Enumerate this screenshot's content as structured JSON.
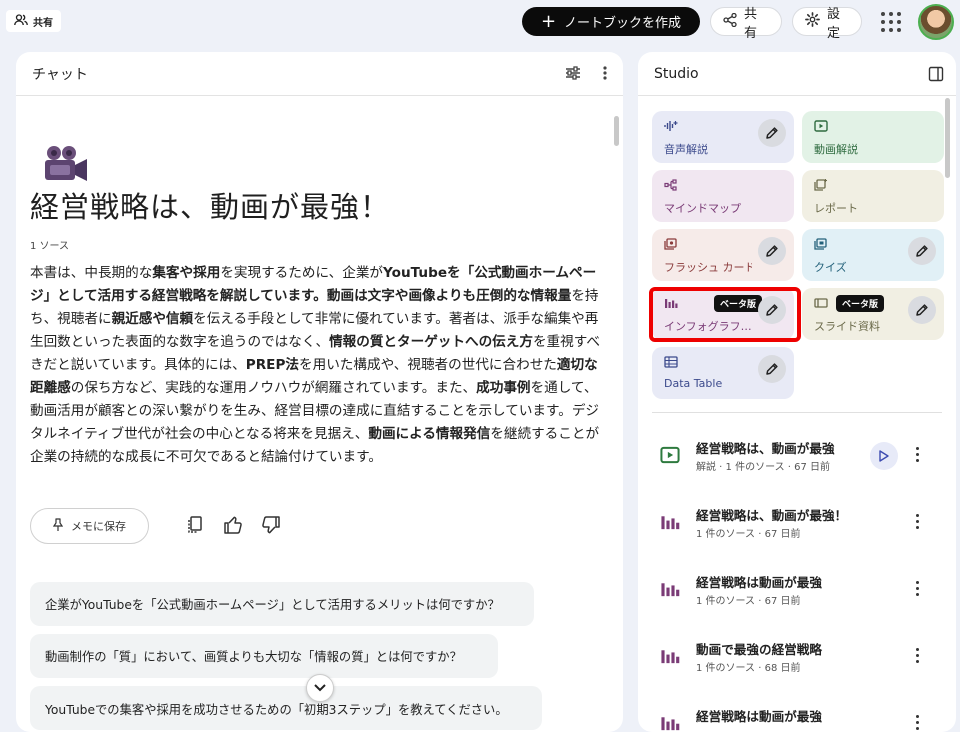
{
  "topbar": {
    "share_chip": "共有",
    "new_notebook": "ノートブックを作成",
    "share_button": "共有",
    "settings_button": "設定"
  },
  "chat": {
    "header": "チャット",
    "title": "経営戦略は、動画が最強！",
    "source_count": "1 ソース",
    "summary": [
      {
        "t": "本書は、中長期的な",
        "b": false
      },
      {
        "t": "集客や採用",
        "b": true
      },
      {
        "t": "を実現するために、企業が",
        "b": false
      },
      {
        "t": "YouTubeを「公式動画ホームページ」として活用する経営戦略を解説しています。",
        "b": true
      },
      {
        "t": "動画は文字や画像よりも圧倒的な情報量",
        "b": true
      },
      {
        "t": "を持ち、視聴者に",
        "b": false
      },
      {
        "t": "親近感や信頼",
        "b": true
      },
      {
        "t": "を伝える手段として非常に優れています。著者は、派手な編集や再生回数といった表面的な数字を追うのではなく、",
        "b": false
      },
      {
        "t": "情報の質とターゲットへの伝え方",
        "b": true
      },
      {
        "t": "を重視すべきだと説いています。具体的には、",
        "b": false
      },
      {
        "t": "PREP法",
        "b": true
      },
      {
        "t": "を用いた構成や、視聴者の世代に合わせた",
        "b": false
      },
      {
        "t": "適切な距離感",
        "b": true
      },
      {
        "t": "の保ち方など、実践的な運用ノウハウが網羅されています。また、",
        "b": false
      },
      {
        "t": "成功事例",
        "b": true
      },
      {
        "t": "を通して、動画活用が顧客との深い繋がりを生み、経営目標の達成に直結することを示しています。デジタルネイティブ世代が社会の中心となる将来を見据え、",
        "b": false
      },
      {
        "t": "動画による情報発信",
        "b": true
      },
      {
        "t": "を継続することが企業の持続的な成長に不可欠であると結論付けています。",
        "b": false
      }
    ],
    "save_memo": "メモに保存",
    "suggestions": [
      "企業がYouTubeを「公式動画ホームページ」として活用するメリットは何ですか？",
      "動画制作の「質」において、画質よりも大切な「情報の質」とは何ですか？",
      "YouTubeでの集客や採用を成功させるための「初期3ステップ」を教えてください。"
    ]
  },
  "studio": {
    "header": "Studio",
    "tiles": [
      {
        "label": "音声解説",
        "icon": "audio-wave-icon",
        "bg": "#e8eaf6",
        "fg": "#3c4a8c",
        "edit": true,
        "beta": ""
      },
      {
        "label": "動画解説",
        "icon": "video-play-icon",
        "bg": "#e2f2e6",
        "fg": "#2e6b3f",
        "edit": false,
        "beta": ""
      },
      {
        "label": "マインドマップ",
        "icon": "mindmap-icon",
        "bg": "#f1e7f1",
        "fg": "#7a3b76",
        "edit": false,
        "beta": ""
      },
      {
        "label": "レポート",
        "icon": "report-icon",
        "bg": "#f1efe3",
        "fg": "#6b6a4a",
        "edit": false,
        "beta": ""
      },
      {
        "label": "フラッシュ カード",
        "icon": "flashcard-icon",
        "bg": "#f6ebe9",
        "fg": "#8a3b3b",
        "edit": true,
        "beta": ""
      },
      {
        "label": "クイズ",
        "icon": "quiz-icon",
        "bg": "#e1f0f6",
        "fg": "#23617a",
        "edit": true,
        "beta": ""
      },
      {
        "label": "インフォグラフ…",
        "icon": "infographic-icon",
        "bg": "#f1e7f1",
        "fg": "#7a3b76",
        "edit": true,
        "beta": "ベータ版"
      },
      {
        "label": "スライド資料",
        "icon": "slides-icon",
        "bg": "#f1efe3",
        "fg": "#6b6a4a",
        "edit": true,
        "beta": "ベータ版"
      },
      {
        "label": "Data Table",
        "icon": "table-icon",
        "bg": "#e8eaf6",
        "fg": "#3c4a8c",
        "edit": true,
        "beta": ""
      }
    ],
    "notes": [
      {
        "title": "経営戦略は、動画が最強",
        "sub": "解説 · 1 件のソース · 67 日前",
        "icon": "video-play-icon",
        "play": true
      },
      {
        "title": "経営戦略は、動画が最強！",
        "sub": "1 件のソース · 67 日前",
        "icon": "infographic-icon",
        "play": false
      },
      {
        "title": "経営戦略は動画が最強",
        "sub": "1 件のソース · 67 日前",
        "icon": "infographic-icon",
        "play": false
      },
      {
        "title": "動画で最強の経営戦略",
        "sub": "1 件のソース · 68 日前",
        "icon": "infographic-icon",
        "play": false
      },
      {
        "title": "経営戦略は動画が最強",
        "sub": "",
        "icon": "infographic-icon",
        "play": false
      }
    ]
  }
}
